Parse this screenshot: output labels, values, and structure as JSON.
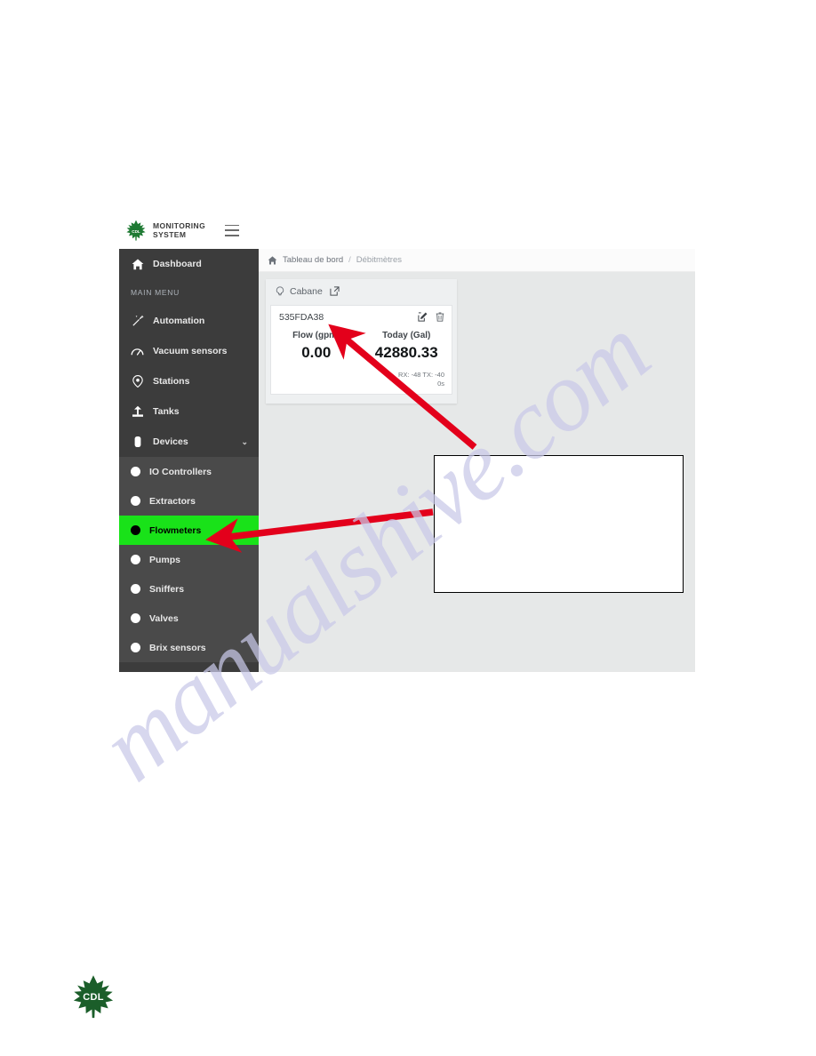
{
  "app": {
    "brand_line1": "MONITORING",
    "brand_line2": "SYSTEM",
    "logo_text": "CDL",
    "menu_icon": "hamburger-icon"
  },
  "breadcrumb": {
    "home_icon": "home-icon",
    "first": "Tableau de bord",
    "separator": "/",
    "second": "Débitmètres"
  },
  "sidebar": {
    "dashboard": {
      "label": "Dashboard",
      "icon": "home-icon"
    },
    "section_label": "MAIN MENU",
    "items": [
      {
        "label": "Automation",
        "icon": "magic-wand-icon"
      },
      {
        "label": "Vacuum sensors",
        "icon": "gauge-icon"
      },
      {
        "label": "Stations",
        "icon": "map-pin-icon"
      },
      {
        "label": "Tanks",
        "icon": "tank-icon"
      },
      {
        "label": "Devices",
        "icon": "device-icon",
        "expanded": true,
        "chevron": "⌄"
      }
    ],
    "devices_children": [
      {
        "label": "IO Controllers",
        "active": false
      },
      {
        "label": "Extractors",
        "active": false
      },
      {
        "label": "Flowmeters",
        "active": true
      },
      {
        "label": "Pumps",
        "active": false
      },
      {
        "label": "Sniffers",
        "active": false
      },
      {
        "label": "Valves",
        "active": false
      },
      {
        "label": "Brix sensors",
        "active": false
      }
    ]
  },
  "station_panel": {
    "name": "Cabane",
    "pin_icon": "map-pin-icon",
    "external_link_icon": "external-link-icon"
  },
  "meter_card": {
    "title": "535FDA38",
    "edit_icon": "edit-icon",
    "delete_icon": "trash-icon",
    "metrics": [
      {
        "label": "Flow (gpm)",
        "value": "0.00"
      },
      {
        "label": "Today (Gal)",
        "value": "42880.33"
      }
    ],
    "signal_line1": "RX: -48 TX: -40",
    "signal_line2": "0s"
  },
  "watermark": {
    "text": "manualshive.com"
  },
  "footer": {
    "logo_text": "CDL"
  },
  "colors": {
    "sidebar_bg": "#3c3c3c",
    "sidebar_sub_bg": "#4a4a4a",
    "active_highlight": "#19e219",
    "content_bg": "#e6e8e8",
    "arrow_red": "#e3001b",
    "brand_green": "#1e7a33",
    "watermark_purple": "#c9c9e8"
  }
}
